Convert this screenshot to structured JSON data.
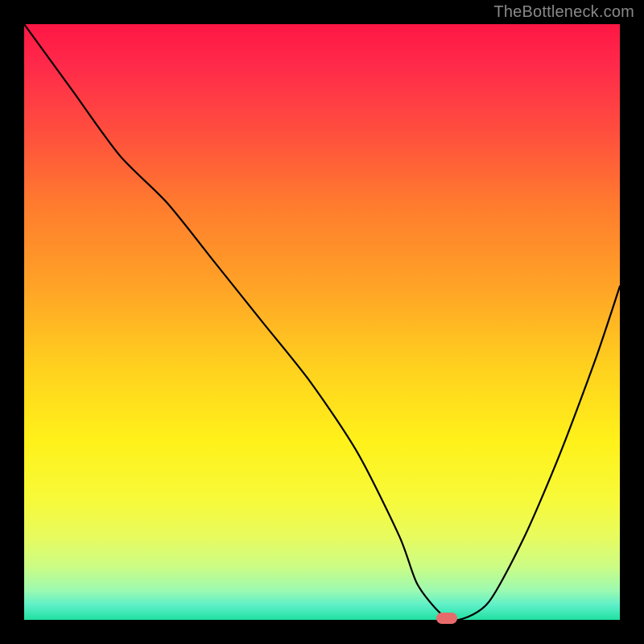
{
  "watermark_text": "TheBottleneck.com",
  "colors": {
    "black": "#000000",
    "curve": "#000000",
    "marker": "#e86b6b",
    "gradient_stops": [
      {
        "offset": 0.0,
        "color": "#ff1744"
      },
      {
        "offset": 0.07,
        "color": "#ff2a4a"
      },
      {
        "offset": 0.18,
        "color": "#ff4e3e"
      },
      {
        "offset": 0.3,
        "color": "#ff7a2e"
      },
      {
        "offset": 0.45,
        "color": "#ffa626"
      },
      {
        "offset": 0.58,
        "color": "#ffd21e"
      },
      {
        "offset": 0.7,
        "color": "#fff11a"
      },
      {
        "offset": 0.8,
        "color": "#f7fa3a"
      },
      {
        "offset": 0.86,
        "color": "#e8fb5e"
      },
      {
        "offset": 0.91,
        "color": "#ccfc84"
      },
      {
        "offset": 0.95,
        "color": "#9dfab0"
      },
      {
        "offset": 0.975,
        "color": "#5ef0c9"
      },
      {
        "offset": 1.0,
        "color": "#20e0a0"
      }
    ]
  },
  "chart_data": {
    "type": "line",
    "title": "",
    "xlabel": "",
    "ylabel": "",
    "xlim": [
      0,
      100
    ],
    "ylim": [
      0,
      100
    ],
    "series": [
      {
        "name": "bottleneck-curve",
        "x": [
          0,
          8,
          16,
          24,
          32,
          40,
          48,
          56,
          63,
          66,
          70,
          73,
          78,
          84,
          90,
          96,
          100
        ],
        "values": [
          100,
          89,
          78,
          70,
          60,
          50,
          40,
          28,
          14,
          6,
          1,
          0,
          3,
          14,
          28,
          44,
          56
        ]
      }
    ],
    "marker": {
      "x": 71,
      "y": 0
    },
    "notes": "Heatmap-style vertical gradient background from red (top, high bottleneck) to green (bottom, low bottleneck); black V-shaped curve dips to zero around x≈71 where a small rounded red marker sits on the x-axis."
  }
}
